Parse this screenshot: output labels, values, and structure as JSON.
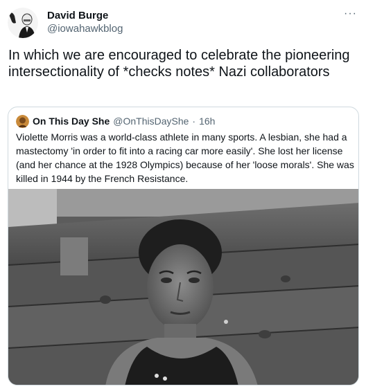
{
  "author": {
    "display_name": "David Burge",
    "handle": "@iowahawkblog"
  },
  "more_menu": "···",
  "tweet_text": "In which we are encouraged to celebrate the pioneering intersectionality of *checks notes* Nazi collaborators",
  "quoted": {
    "display_name": "On This Day She",
    "handle": "@OnThisDayShe",
    "separator": "·",
    "time": "16h",
    "text": "Violette Morris was a world-class athlete in many sports. A lesbian, she had a mastectomy 'in order to fit into a racing car more easily'. She lost her license (and her chance at the 1928 Olympics) because of her 'loose morals'. She was killed in 1944 by the French Resistance."
  }
}
